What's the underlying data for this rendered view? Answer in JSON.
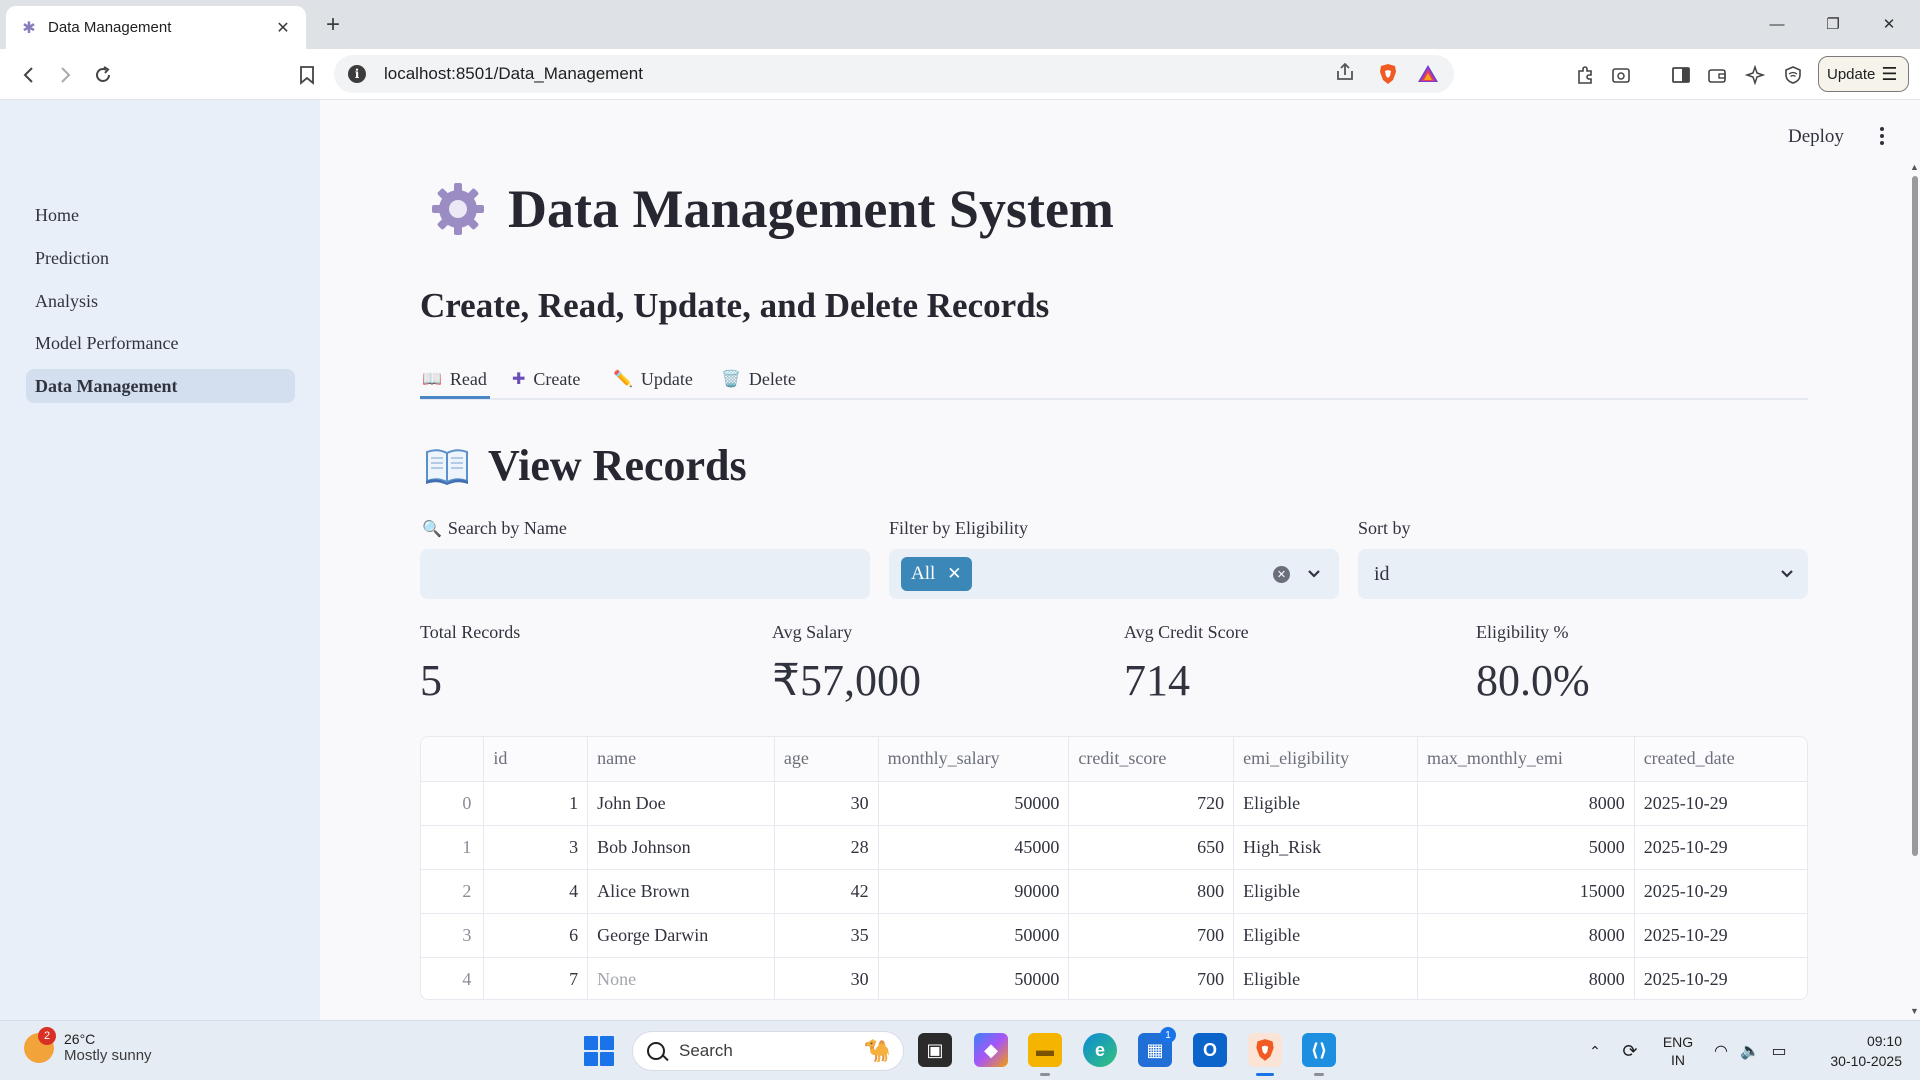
{
  "browser": {
    "tab_title": "Data Management",
    "url": "localhost:8501/Data_Management",
    "update_label": "Update"
  },
  "sidebar": {
    "items": [
      {
        "label": "Home"
      },
      {
        "label": "Prediction"
      },
      {
        "label": "Analysis"
      },
      {
        "label": "Model Performance"
      },
      {
        "label": "Data Management",
        "active": true
      }
    ]
  },
  "header": {
    "deploy_label": "Deploy"
  },
  "page": {
    "title": "Data Management System",
    "subtitle": "Create, Read, Update, and Delete Records",
    "tabs": [
      {
        "icon": "📖",
        "label": "Read",
        "active": true
      },
      {
        "icon": "➕",
        "label": "Create"
      },
      {
        "icon": "✏️",
        "label": "Update"
      },
      {
        "icon": "🗑️",
        "label": "Delete"
      }
    ],
    "section_title": "View Records"
  },
  "filters": {
    "search_label": "Search by Name",
    "search_value": "",
    "eligibility_label": "Filter by Eligibility",
    "eligibility_chip": "All",
    "sort_label": "Sort by",
    "sort_value": "id"
  },
  "metrics": [
    {
      "label": "Total Records",
      "value": "5"
    },
    {
      "label": "Avg Salary",
      "value": "₹57,000"
    },
    {
      "label": "Avg Credit Score",
      "value": "714"
    },
    {
      "label": "Eligibility %",
      "value": "80.0%"
    }
  ],
  "table": {
    "columns": [
      "",
      "id",
      "name",
      "age",
      "monthly_salary",
      "credit_score",
      "emi_eligibility",
      "max_monthly_emi",
      "created_date"
    ],
    "rows": [
      [
        "0",
        "1",
        "John Doe",
        "30",
        "50000",
        "720",
        "Eligible",
        "8000",
        "2025-10-29"
      ],
      [
        "1",
        "3",
        "Bob Johnson",
        "28",
        "45000",
        "650",
        "High_Risk",
        "5000",
        "2025-10-29"
      ],
      [
        "2",
        "4",
        "Alice Brown",
        "42",
        "90000",
        "800",
        "Eligible",
        "15000",
        "2025-10-29"
      ],
      [
        "3",
        "6",
        "George Darwin",
        "35",
        "50000",
        "700",
        "Eligible",
        "8000",
        "2025-10-29"
      ],
      [
        "4",
        "7",
        "None",
        "30",
        "50000",
        "700",
        "Eligible",
        "8000",
        "2025-10-29"
      ]
    ]
  },
  "taskbar": {
    "temperature": "26°C",
    "weather": "Mostly sunny",
    "weather_badge": "2",
    "search_label": "Search",
    "store_badge": "1",
    "lang_1": "ENG",
    "lang_2": "IN",
    "time": "09:10",
    "date": "30-10-2025"
  }
}
